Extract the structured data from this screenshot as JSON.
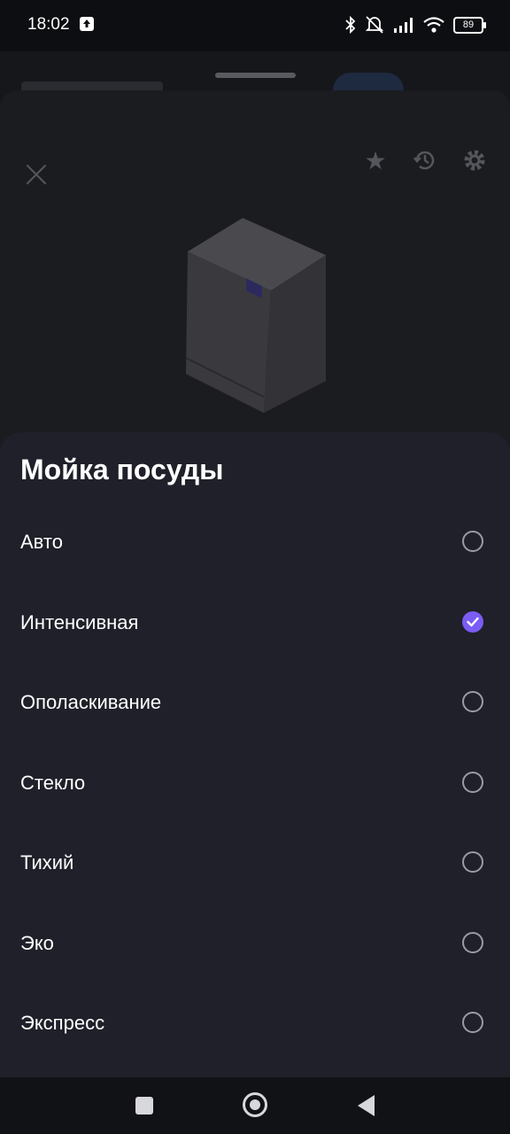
{
  "status_bar": {
    "time": "18:02",
    "battery": "89",
    "icons": [
      "upload-icon",
      "bluetooth-icon",
      "mute-icon",
      "signal-icon",
      "wifi-icon",
      "battery-icon"
    ]
  },
  "sheet": {
    "title": "Мойка посуды",
    "selected_color": "#7b5cf5",
    "options": [
      {
        "label": "Авто",
        "selected": false
      },
      {
        "label": "Интенсивная",
        "selected": true
      },
      {
        "label": "Ополаскивание",
        "selected": false
      },
      {
        "label": "Стекло",
        "selected": false
      },
      {
        "label": "Тихий",
        "selected": false
      },
      {
        "label": "Эко",
        "selected": false
      },
      {
        "label": "Экспресс",
        "selected": false
      }
    ]
  },
  "background_icons": [
    "close-icon",
    "star-icon",
    "history-icon",
    "gear-icon",
    "dishwasher-image"
  ],
  "nav_bar": {
    "icons": [
      "recents-icon",
      "home-icon",
      "back-icon"
    ]
  }
}
